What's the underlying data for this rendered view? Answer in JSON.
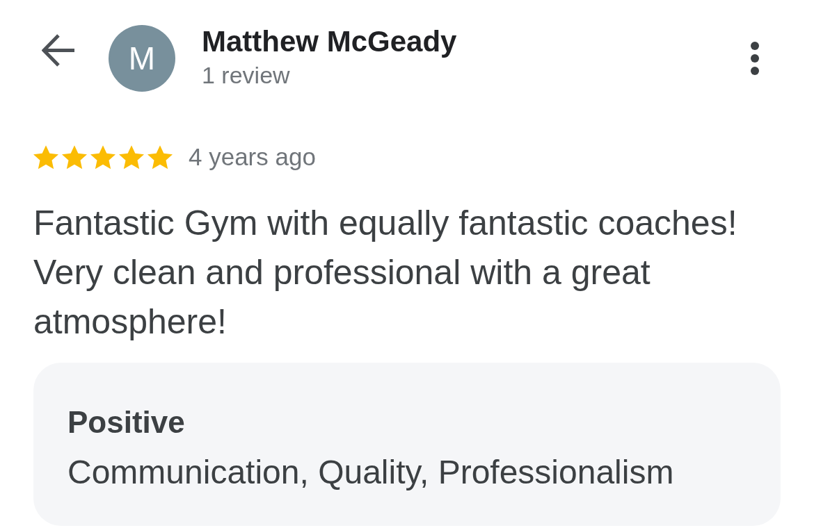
{
  "header": {
    "avatar_letter": "M",
    "reviewer_name": "Matthew McGeady",
    "review_count": "1 review"
  },
  "review": {
    "stars": 5,
    "time": "4 years ago",
    "text": "Fantastic Gym with equally fantastic coaches! Very clean and professional with a great atmosphere!"
  },
  "highlights": {
    "title": "Positive",
    "items": "Communication, Quality, Professionalism"
  }
}
